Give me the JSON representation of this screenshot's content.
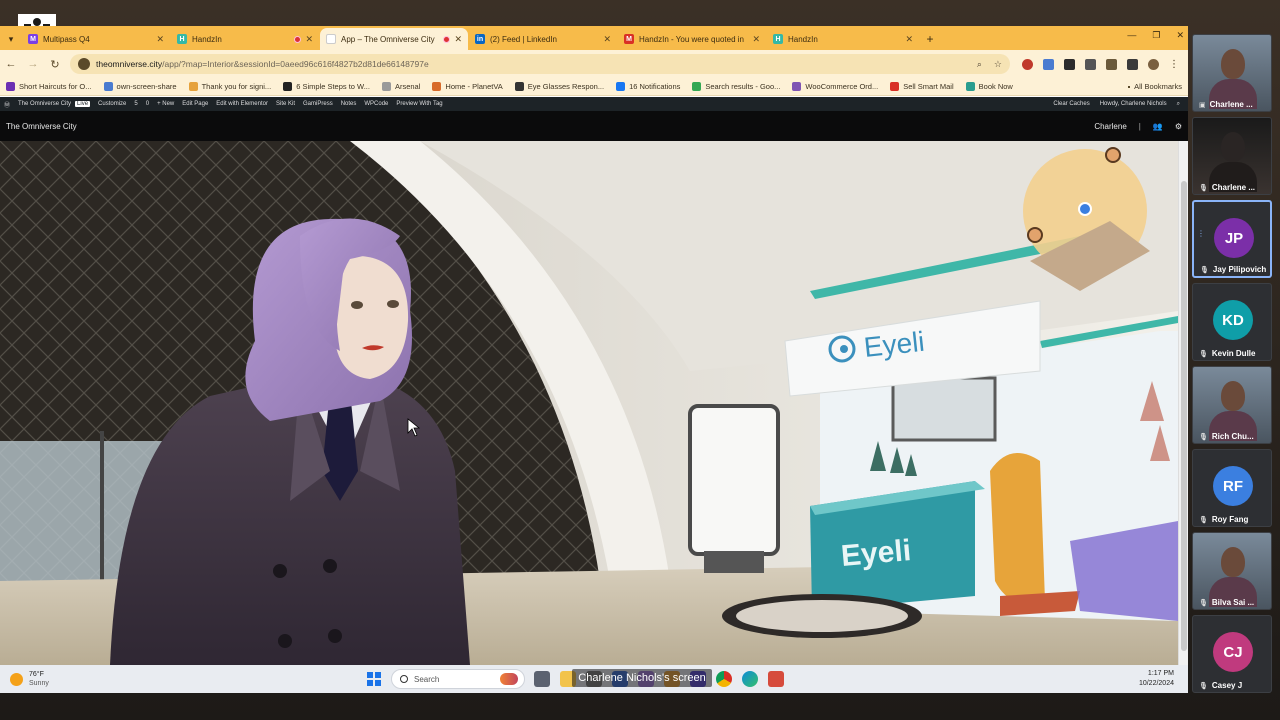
{
  "tabs": [
    {
      "label": "Multipass Q4",
      "favicon_color": "#7b3fe4"
    },
    {
      "label": "HandzIn",
      "favicon_color": "#35b8a6"
    },
    {
      "label": "App – The Omniverse City",
      "favicon_color": "#ffffff",
      "active": true
    },
    {
      "label": "(2) Feed | LinkedIn",
      "favicon_color": "#0a66c2"
    },
    {
      "label": "HandzIn - You were quoted in",
      "favicon_color": "#d93025"
    },
    {
      "label": "HandzIn",
      "favicon_color": "#35b8a6"
    }
  ],
  "address": {
    "host": "theomniverse.city",
    "rest": "/app/?map=Interior&sessionId=0aeed96c616f4827b2d81de66148797e"
  },
  "bookmarks": [
    {
      "label": "Short Haircuts for O...",
      "color": "#6b2fb3"
    },
    {
      "label": "own-screen-share",
      "color": "#4a7bd0"
    },
    {
      "label": "Thank you for signi...",
      "color": "#e6a23c"
    },
    {
      "label": "6 Simple Steps to W...",
      "color": "#222222"
    },
    {
      "label": "Arsenal",
      "color": "#9a9a9a"
    },
    {
      "label": "Home - PlanetVA",
      "color": "#d86b2a"
    },
    {
      "label": "Eye Glasses Respon...",
      "color": "#333333"
    },
    {
      "label": "16 Notifications",
      "color": "#1877f2"
    },
    {
      "label": "Search results - Goo...",
      "color": "#34a853"
    },
    {
      "label": "WooCommerce Ord...",
      "color": "#7f54b3"
    },
    {
      "label": "Sell Smart Mail",
      "color": "#d93025"
    },
    {
      "label": "Book Now",
      "color": "#2a9d8f"
    }
  ],
  "all_bookmarks": "All Bookmarks",
  "wp_bar": {
    "items": [
      "The Omniverse City",
      "Live",
      "Customize",
      "5",
      "0",
      "+ New",
      "Edit Page",
      "Edit with Elementor",
      "Site Kit",
      "GamiPress",
      "Notes",
      "WPCode",
      "Preview With Tag"
    ],
    "right": [
      "Clear Caches",
      "Howdy, Charlene Nichols"
    ]
  },
  "app_header": {
    "title": "The Omniverse City",
    "user": "Charlene",
    "separator": "|"
  },
  "scene": {
    "sign_text": "Eyeli",
    "desk_text": "Eyeli"
  },
  "taskbar": {
    "temperature": "76°F",
    "condition": "Sunny",
    "search_placeholder": "Search",
    "time": "1:17 PM",
    "date": "10/22/2024"
  },
  "share_caption": "Charlene Nichols's screen",
  "participants": [
    {
      "name": "Charlene ...",
      "type": "video",
      "speaking": false
    },
    {
      "name": "Charlene ...",
      "type": "video-dark",
      "speaking": false
    },
    {
      "name": "Jay Pilipovich",
      "initials": "JP",
      "color": "#7b2fa8",
      "speaking": true
    },
    {
      "name": "Kevin Dulle",
      "initials": "KD",
      "color": "#0f9ea8",
      "speaking": false
    },
    {
      "name": "Rich Chu...",
      "type": "video",
      "speaking": false
    },
    {
      "name": "Roy Fang",
      "initials": "RF",
      "color": "#3b7fe0",
      "speaking": false
    },
    {
      "name": "Bilva Sai ...",
      "type": "video",
      "speaking": false
    },
    {
      "name": "Casey J",
      "initials": "CJ",
      "color": "#c03a7e",
      "speaking": false
    }
  ]
}
